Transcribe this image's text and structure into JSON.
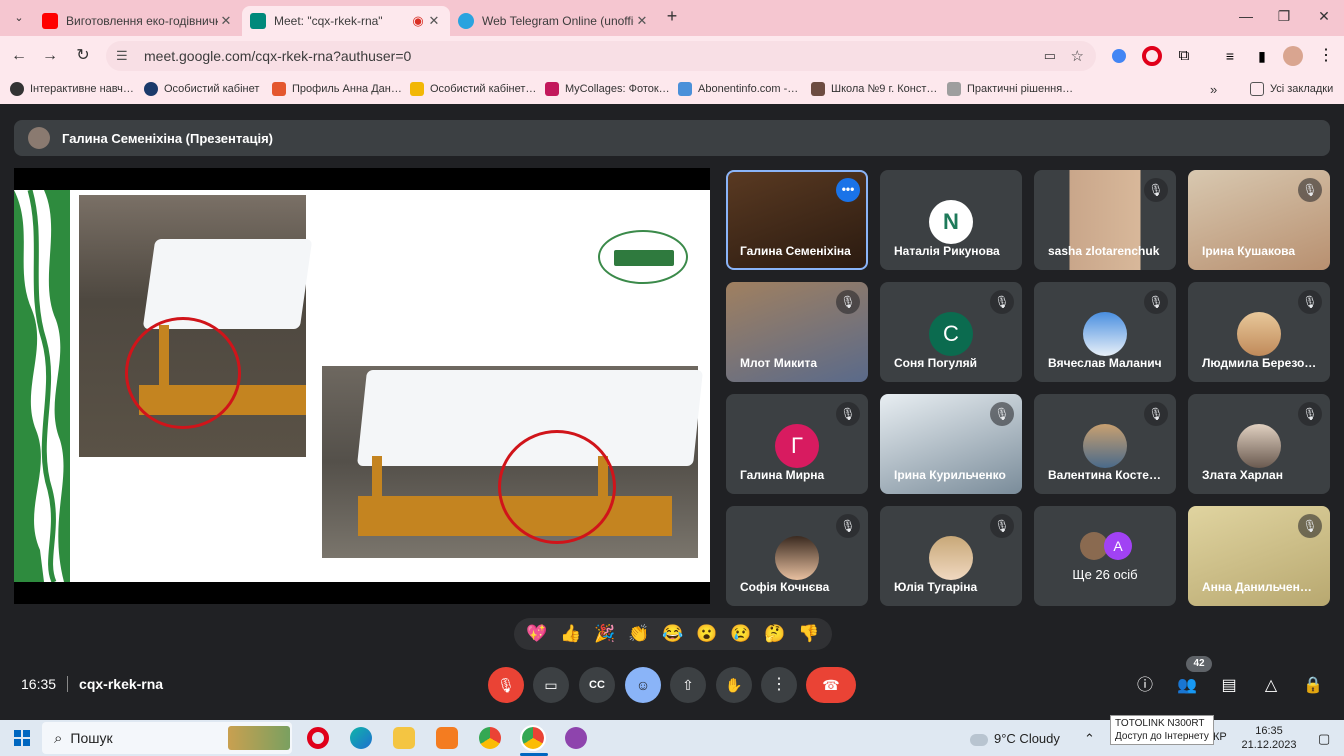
{
  "browser": {
    "tabs": [
      {
        "title": "Виготовлення еко-годівничк",
        "favicon_color": "#ff0000"
      },
      {
        "title": "Meet: \"cqx-rkek-rna\"",
        "favicon_color": "#00897b"
      },
      {
        "title": "Web Telegram Online (unoffici",
        "favicon_color": "#2aa3df"
      }
    ],
    "url": "meet.google.com/cqx-rkek-rna?authuser=0",
    "bookmarks": [
      "Інтерактивне навч…",
      "Особистий кабінет",
      "Профиль Анна Дан…",
      "Особистий кабінет…",
      "MyCollages: Фоток…",
      "Abonentinfo.com -…",
      "Школа №9 г. Конст…",
      "Практичні рішення…"
    ],
    "all_bookmarks": "Усі закладки"
  },
  "meet": {
    "presenter": "Галина Семеніхіна (Презентація)",
    "participants": [
      {
        "name": "Галина Семеніхіна",
        "kind": "video",
        "speaking": true
      },
      {
        "name": "Наталія Рикунова",
        "kind": "avatar",
        "initial": "N",
        "color": "#ffffff"
      },
      {
        "name": "sasha zlotarenchuk",
        "kind": "video"
      },
      {
        "name": "Ірина Кушакова",
        "kind": "video"
      },
      {
        "name": "Млот Микита",
        "kind": "video"
      },
      {
        "name": "Соня Погуляй",
        "kind": "avatar",
        "initial": "С",
        "color": "#0b6b4f"
      },
      {
        "name": "Вячеслав Маланич",
        "kind": "photo"
      },
      {
        "name": "Людмила Березо…",
        "kind": "photo"
      },
      {
        "name": "Галина Мирна",
        "kind": "avatar",
        "initial": "Г",
        "color": "#d81b60"
      },
      {
        "name": "Ірина Курильченко",
        "kind": "video"
      },
      {
        "name": "Валентина Косте…",
        "kind": "photo"
      },
      {
        "name": "Злата Харлан",
        "kind": "photo"
      },
      {
        "name": "Софія Кочнєва",
        "kind": "photo"
      },
      {
        "name": "Юлія Тугаріна",
        "kind": "photo"
      },
      {
        "name": "Ще 26 осіб",
        "kind": "more",
        "initial": "A"
      },
      {
        "name": "Анна Данильчен…",
        "kind": "video"
      }
    ],
    "reactions": [
      "💖",
      "👍",
      "🎉",
      "👏",
      "😂",
      "😮",
      "😢",
      "🤔",
      "👎"
    ],
    "time": "16:35",
    "meeting_code": "cqx-rkek-rna",
    "participants_count": "42"
  },
  "taskbar": {
    "search": "Пошук",
    "weather": "9°C  Cloudy",
    "lang": "УКР",
    "clock_time": "16:35",
    "clock_date": "21.12.2023",
    "tooltip_line1": "TOTOLINK N300RT",
    "tooltip_line2": "Доступ до Інтернету"
  }
}
